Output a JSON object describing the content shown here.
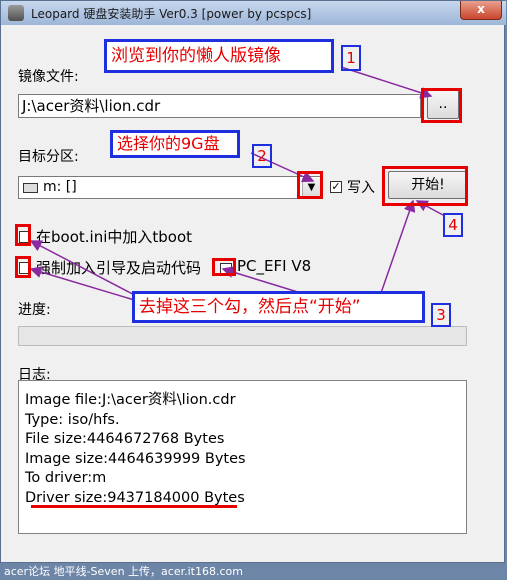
{
  "window": {
    "title": "Leopard 硬盘安装助手 Ver0.3 [power by pcspcs]",
    "close_glyph": "x"
  },
  "image_file": {
    "label": "镜像文件:",
    "value": "J:\\acer资料\\lion.cdr",
    "browse_label": ".."
  },
  "target": {
    "label": "目标分区:",
    "selected": "m: []",
    "write_label": "写入",
    "write_checked": true,
    "start_label": "开始!"
  },
  "options": {
    "tboot_label": "在boot.ini中加入tboot",
    "tboot_checked": false,
    "force_boot_label": "强制加入引导及启动代码",
    "force_boot_checked": false,
    "pc_efi_label": "PC_EFI V8",
    "pc_efi_checked": false
  },
  "progress": {
    "label": "进度:",
    "value": 0
  },
  "log": {
    "label": "日志:",
    "lines": [
      "Image file:J:\\acer资料\\lion.cdr",
      "Type: iso/hfs.",
      "File size:4464672768 Bytes",
      "Image size:4464639999 Bytes",
      "To driver:m",
      "Driver size:9437184000 Bytes"
    ]
  },
  "annotations": {
    "note1": "浏览到你的懒人版镜像",
    "num1": "1",
    "note2": "选择你的9G盘",
    "num2": "2",
    "note3": "去掉这三个勾，然后点“开始”",
    "num3": "3",
    "num4": "4",
    "color_red": "#e60000",
    "color_blue": "#1e2fe0",
    "color_arrow": "#8a2aa0"
  },
  "watermark": "acer论坛 地平线-Seven 上传，acer.it168.com"
}
